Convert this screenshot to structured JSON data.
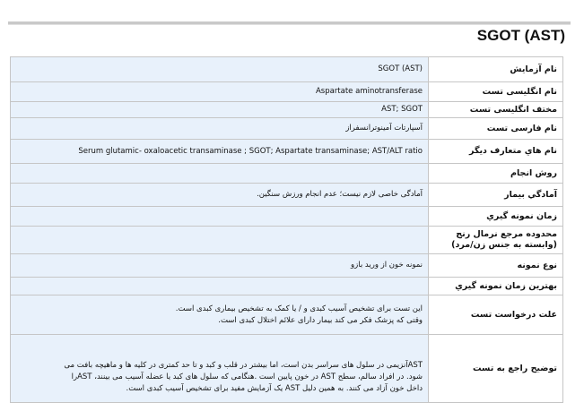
{
  "page_title": "SGOT (AST)",
  "rows": [
    {
      "label": "نام آزمایش",
      "value": "SGOT (AST)"
    },
    {
      "label": "نام انگلیسی تست",
      "value": "Aspartate aminotransferase"
    },
    {
      "label": "مختف انگلیسی تست",
      "value": "AST; SGOT"
    },
    {
      "label": "نام فارسی تست",
      "value": "آسپارتات آمینوترانسفراز"
    },
    {
      "label": "نام هاي متعارف ديگر",
      "value": "Serum glutamic- oxaloacetic transaminase ; SGOT; Aspartate transaminase; AST/ALT ratio"
    },
    {
      "label": "روش انجام",
      "value": ""
    },
    {
      "label": "آمادگي بيمار",
      "value": "آمادگی خاصی لازم نیست؛ عدم انجام ورزش سنگین."
    },
    {
      "label": "زمان نمونه گيري",
      "value": ""
    },
    {
      "label": "محدوده مرجع نرمال رنج (وابسته به جنس زن/مرد)",
      "value": ""
    },
    {
      "label": "نوع نمونه",
      "value": "نمونه خون از ورید بازو"
    },
    {
      "label": "بهترين زمان نمونه گيري",
      "value": ""
    },
    {
      "label": "علت درخواست تست",
      "lines": [
        "این تست برای تشخیص آسیب کبدی و / یا کمک به تشخیص بیماری کبدی است.",
        "وقتی که پزشک فکر می کند بیمار دارای علائم اختلال کبدی است."
      ]
    },
    {
      "label": "توضیح راجع به تست",
      "lines": [
        "ASTآنزیمی در سلول های سراسر بدن است، اما بیشتر در قلب و کبد و تا حد کمتری در کلیه ها و ماهیچه بافت می",
        "شود. در افراد سالم، سطح AST در خون پایین است .هنگامی که سلول های کبد یا عضله آسیب می بینند، ASTرا",
        "داخل خون آزاد می کنند. به همین دلیل AST یک آزمایش مفید برای تشخیص آسیب کبدی است."
      ]
    }
  ]
}
